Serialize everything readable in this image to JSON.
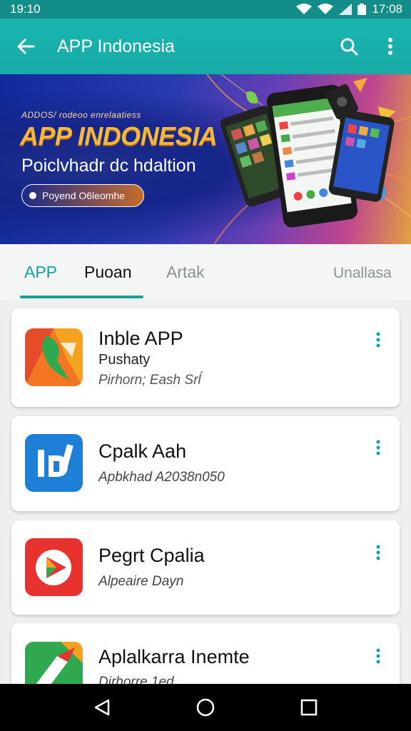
{
  "status": {
    "time_left": "19:10",
    "time_right": "17:08"
  },
  "appbar": {
    "title": "APP Indonesia",
    "back_icon": "arrow-back-icon",
    "search_icon": "search-icon",
    "menu_icon": "more-vert-icon"
  },
  "banner": {
    "tiny": "ADDOS/ rodeoo enrelaatiess",
    "headline": "APP INDONESIA",
    "subtitle": "Poiclvhadr dc hdaltion",
    "pill": "Poyend O6leomhe"
  },
  "tabs": [
    {
      "label": "APP",
      "selected": true
    },
    {
      "label": "Puoan",
      "selected": false
    },
    {
      "label": "Artak",
      "selected": false
    },
    {
      "label": "Unallasa",
      "selected": false
    }
  ],
  "apps": [
    {
      "name": "Inble APP",
      "line2": "Pushaty",
      "line3": "Pirhorn; Eash Srĺ"
    },
    {
      "name": "Cpalk Aah",
      "line2": "",
      "line3": "Apbkhad A2038n050"
    },
    {
      "name": "Pegrt Cpalia",
      "line2": "",
      "line3": "Alpeaire Dayn"
    },
    {
      "name": "Aplalkarra Inemte",
      "line2": "",
      "line3": "Dirhorre 1ed"
    }
  ],
  "colors": {
    "accent": "#14a19c",
    "appbar": "#18aaa6",
    "statusbar": "#138d8a"
  },
  "navbar": {
    "back_icon": "nav-back-icon",
    "home_icon": "nav-home-icon",
    "recents_icon": "nav-recents-icon"
  }
}
